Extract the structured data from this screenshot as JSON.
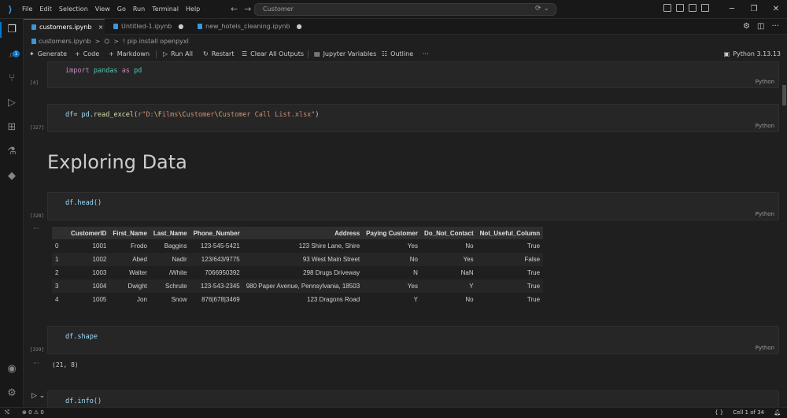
{
  "menu": [
    "File",
    "Edit",
    "Selection",
    "View",
    "Go",
    "Run",
    "Terminal",
    "Help"
  ],
  "search": {
    "label": "Customer"
  },
  "tabs": [
    {
      "label": "customers.ipynb",
      "close": "×"
    },
    {
      "label": "Untitled-1.ipynb",
      "close": "●"
    },
    {
      "label": "new_hotels_cleaning.ipynb",
      "close": "●"
    }
  ],
  "breadcrumb": {
    "file": "customers.ipynb",
    "sep": ">",
    "cell": "! pip install openpyxl"
  },
  "toolbar": {
    "generate": "Generate",
    "code": "Code",
    "markdown": "Markdown",
    "run_all": "Run All",
    "restart": "Restart",
    "clear_outputs": "Clear All Outputs",
    "variables": "Jupyter Variables",
    "outline": "Outline",
    "more": "···",
    "kernel": "Python 3.13.13"
  },
  "cells": {
    "c1": {
      "exec": "[4]",
      "lang": "Python",
      "kw1": "import",
      "mod": "pandas",
      "kw2": "as",
      "alias": "pd"
    },
    "c2": {
      "exec": "[327]",
      "lang": "Python",
      "var": "df",
      "op": "= ",
      "obj": "pd.",
      "fn": "read_excel",
      "open": "(",
      "str1": "r\"D:",
      "esc1": "\\F",
      "str2": "ilms",
      "esc2": "\\C",
      "str3": "ustomer",
      "esc3": "\\C",
      "str4": "ustomer Call List.xlsx\"",
      "close": ")"
    },
    "heading": "Exploring Data",
    "c3": {
      "exec": "[328]",
      "lang": "Python",
      "code": "df.head()",
      "out_marker": "···"
    },
    "c4": {
      "exec": "[329]",
      "lang": "Python",
      "code": "df.shape",
      "out_marker": "···",
      "output": "(21, 8)"
    },
    "c5": {
      "code": "df.info()"
    }
  },
  "dataframe": {
    "columns": [
      "",
      "CustomerID",
      "First_Name",
      "Last_Name",
      "Phone_Number",
      "Address",
      "Paying Customer",
      "Do_Not_Contact",
      "Not_Useful_Column"
    ],
    "rows": [
      [
        "0",
        "1001",
        "Frodo",
        "Baggins",
        "123-545-5421",
        "123 Shire Lane, Shire",
        "Yes",
        "No",
        "True"
      ],
      [
        "1",
        "1002",
        "Abed",
        "Nadir",
        "123/643/9775",
        "93 West Main Street",
        "No",
        "Yes",
        "False"
      ],
      [
        "2",
        "1003",
        "Walter",
        "/White",
        "7066950392",
        "298 Drugs Driveway",
        "N",
        "NaN",
        "True"
      ],
      [
        "3",
        "1004",
        "Dwight",
        "Schrute",
        "123-543-2345",
        "980 Paper Avenue, Pennsylvania, 18503",
        "Yes",
        "Y",
        "True"
      ],
      [
        "4",
        "1005",
        "Jon",
        "Snow",
        "876|678|3469",
        "123 Dragons Road",
        "Y",
        "No",
        "True"
      ]
    ]
  },
  "status": {
    "errors": "0",
    "warnings": "0",
    "cell_position": "Cell 1 of 34",
    "braces": "{ }"
  },
  "icons": [
    "files-icon",
    "search-icon",
    "source-control-icon",
    "run-debug-icon",
    "extensions-icon",
    "testing-icon",
    "python-icon",
    "account-icon",
    "settings-gear-icon"
  ],
  "colors": {
    "accent": "#0078d4",
    "keyword": "#c586c0",
    "string": "#ce9178",
    "function": "#dcdcaa"
  }
}
